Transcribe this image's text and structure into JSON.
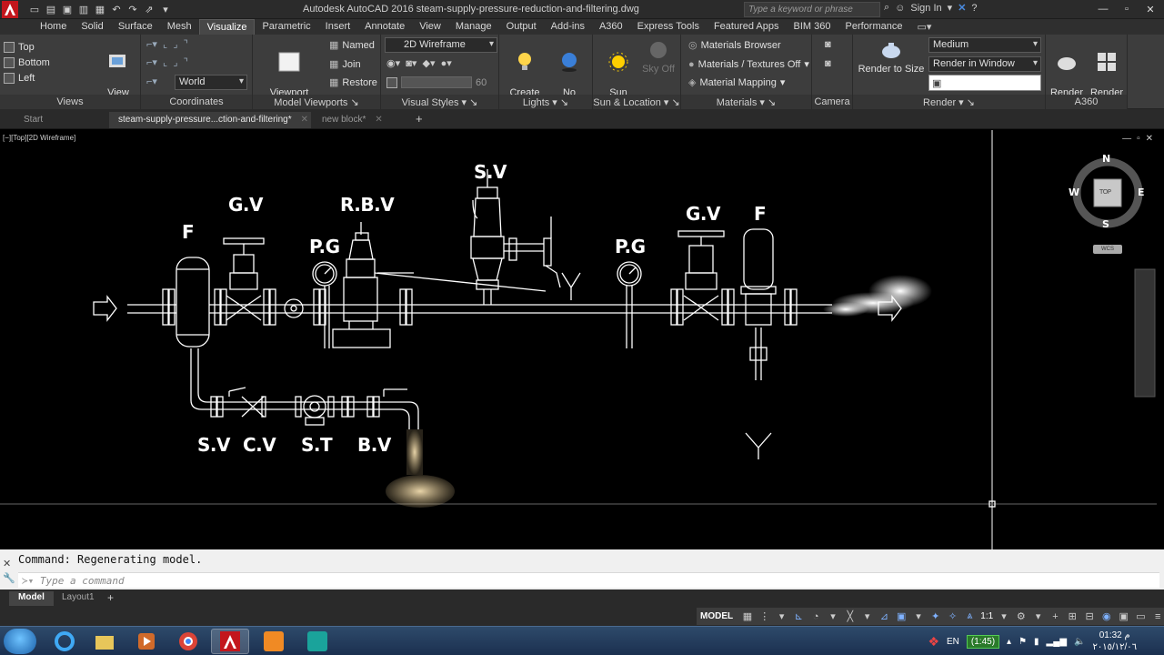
{
  "titlebar": {
    "title": "Autodesk AutoCAD 2016    steam-supply-pressure-reduction-and-filtering.dwg",
    "search_placeholder": "Type a keyword or phrase",
    "sign_in": "Sign In"
  },
  "tabs": [
    "Home",
    "Solid",
    "Surface",
    "Mesh",
    "Visualize",
    "Parametric",
    "Insert",
    "Annotate",
    "View",
    "Manage",
    "Output",
    "Add-ins",
    "A360",
    "Express Tools",
    "Featured Apps",
    "BIM 360",
    "Performance"
  ],
  "active_tab": "Visualize",
  "ribbon": {
    "views": {
      "label": "Views",
      "items": [
        "Top",
        "Bottom",
        "Left"
      ],
      "view_manager": "View\nManager"
    },
    "coordinates": {
      "label": "Coordinates",
      "world": "World"
    },
    "model_viewports": {
      "label": "Model Viewports",
      "config": "Viewport\nConfiguration",
      "named": "Named",
      "join": "Join",
      "restore": "Restore"
    },
    "visual_styles": {
      "label": "Visual Styles",
      "style": "2D Wireframe",
      "opacity": "60"
    },
    "lights": {
      "label": "Lights",
      "create_light": "Create\nLight",
      "no_shadows": "No\nShadows"
    },
    "sun_location": {
      "label": "Sun & Location",
      "sun_status": "Sun\nStatus",
      "sky_off": "Sky Off"
    },
    "materials": {
      "label": "Materials",
      "browser": "Materials Browser",
      "textures": "Materials / Textures Off",
      "mapping": "Material Mapping"
    },
    "camera": {
      "label": "Camera"
    },
    "render": {
      "label": "Render",
      "render_to_size": "Render to Size",
      "quality": "Medium",
      "target": "Render in Window"
    },
    "a360": {
      "label": "A360",
      "cloud": "Render in\nCloud",
      "gallery": "Render\nGallery"
    }
  },
  "file_tabs": [
    "Start",
    "steam-supply-pressure...ction-and-filtering*",
    "new block*"
  ],
  "canvas": {
    "view_label": "[−][Top][2D Wireframe]",
    "compass": {
      "n": "N",
      "s": "S",
      "e": "E",
      "w": "W",
      "top": "TOP",
      "wcs": "WCS"
    },
    "labels": {
      "f1": "F",
      "gv1": "G.V",
      "pg1": "P.G",
      "rbv": "R.B.V",
      "sv_top": "S.V",
      "pg2": "P.G",
      "gv2": "G.V",
      "f2": "F",
      "sv_bottom": "S.V",
      "cv": "C.V",
      "st": "S.T",
      "bv": "B.V"
    }
  },
  "command": {
    "history": "Command: Regenerating model.",
    "placeholder": "Type a command"
  },
  "layout_tabs": [
    "Model",
    "Layout1"
  ],
  "status": {
    "model": "MODEL",
    "scale": "1:1"
  },
  "tray": {
    "lang": "EN",
    "battery": "(1:45)",
    "time": "01:32 م",
    "date": "٢٠١٥/١٢/٠٦"
  },
  "colors": {
    "accent": "#0078d7",
    "ribbon_bg": "#3d3d3d",
    "canvas_bg": "#000000"
  }
}
